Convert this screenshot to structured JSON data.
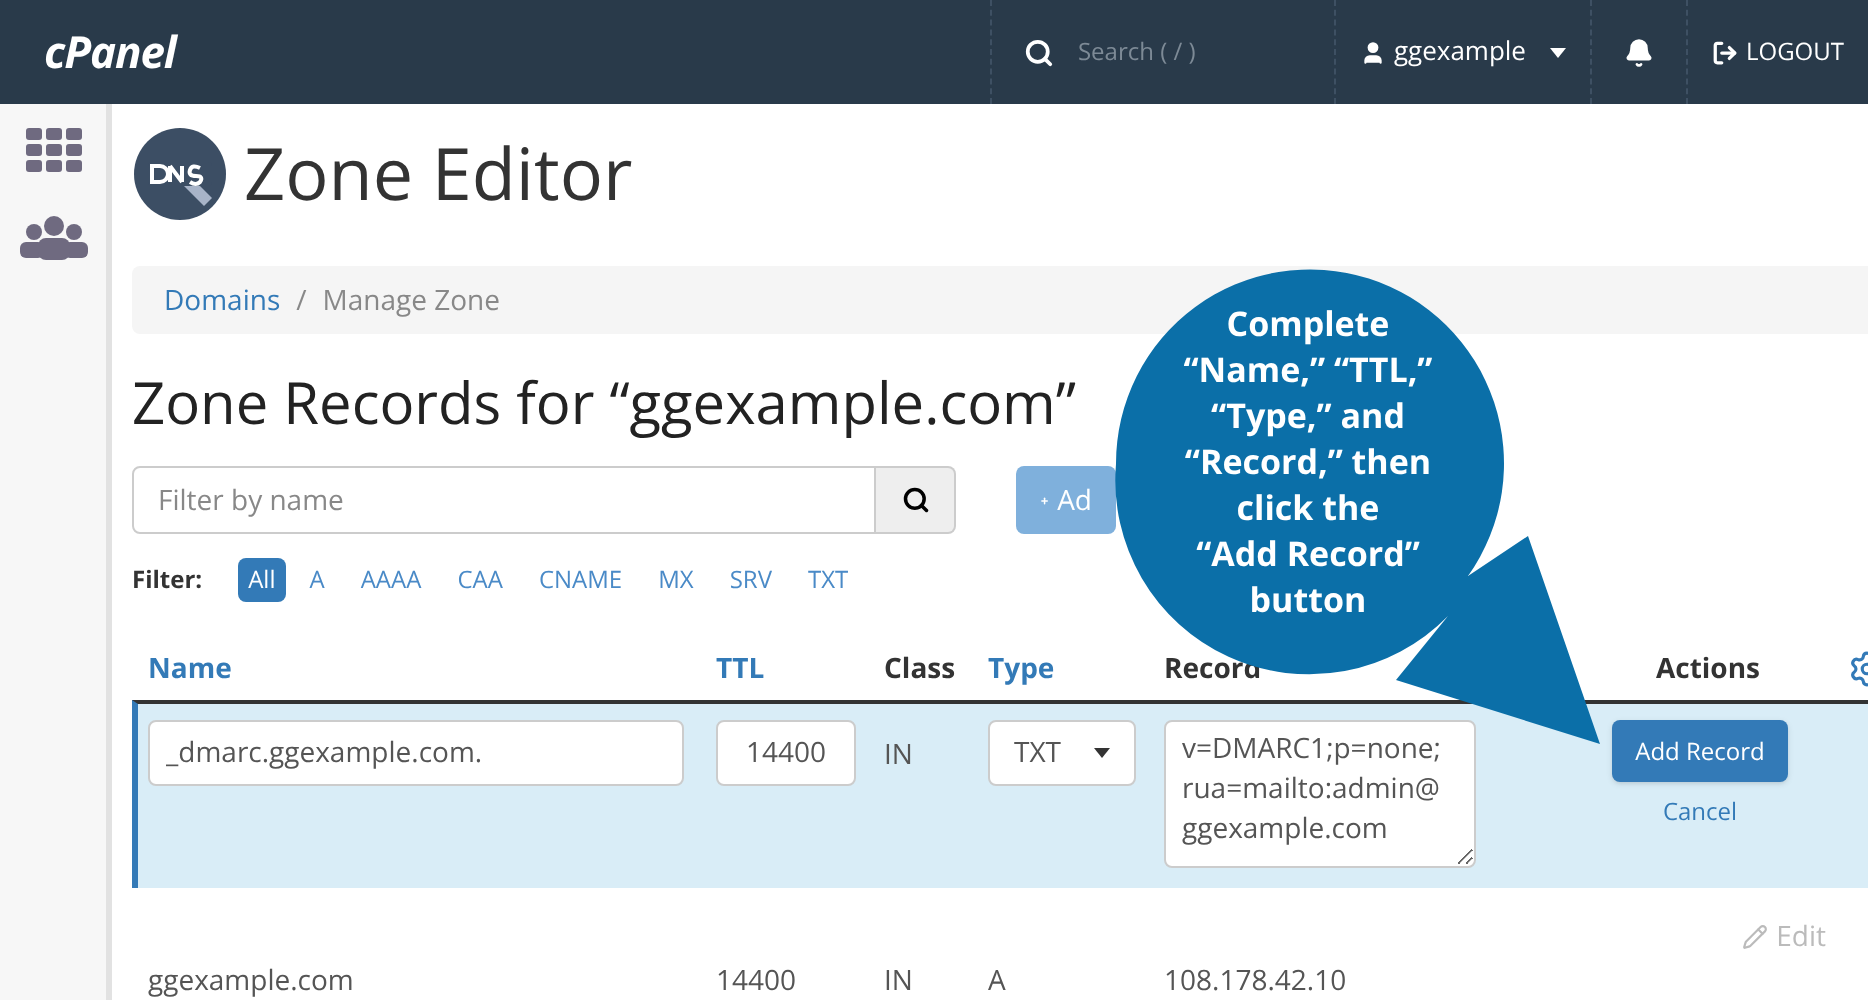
{
  "header": {
    "logo": "cPanel",
    "search": {
      "placeholder": "Search ( / )"
    },
    "user": "ggexample",
    "logout": "LOGOUT"
  },
  "page_title": "Zone Editor",
  "breadcrumb": [
    {
      "label": "Domains",
      "link": true
    },
    {
      "label": "/",
      "link": false
    },
    {
      "label": "Manage Zone",
      "link": false
    }
  ],
  "heading": "Zone Records for “ggexample.com”",
  "filter_field": {
    "placeholder": "Filter by name"
  },
  "add_button": "Ad",
  "filter": {
    "label": "Filter:",
    "options": [
      {
        "label": "All",
        "selected": true
      },
      {
        "label": "A",
        "selected": false
      },
      {
        "label": "AAAA",
        "selected": false
      },
      {
        "label": "CAA",
        "selected": false
      },
      {
        "label": "CNAME",
        "selected": false
      },
      {
        "label": "MX",
        "selected": false
      },
      {
        "label": "SRV",
        "selected": false
      },
      {
        "label": "TXT",
        "selected": false
      }
    ]
  },
  "table": {
    "columns": [
      {
        "label": "Name",
        "sortable": true
      },
      {
        "label": "TTL",
        "sortable": true
      },
      {
        "label": "Class",
        "sortable": false
      },
      {
        "label": "Type",
        "sortable": true
      },
      {
        "label": "Record",
        "sortable": false
      },
      {
        "label": "Actions",
        "sortable": false
      }
    ],
    "edit_row": {
      "name": "_dmarc.ggexample.com.",
      "ttl": "14400",
      "class": "IN",
      "type": "TXT",
      "record": "v=DMARC1;p=none;\nrua=mailto:admin@\nggexample.com",
      "save": "Add Record",
      "cancel": "Cancel"
    },
    "rows": [
      {
        "name": "ggexample.com",
        "ttl": "14400",
        "class": "IN",
        "type": "A",
        "record": "108.178.42.10",
        "action": "Edit"
      }
    ]
  },
  "callout": [
    "Complete",
    "“Name,” “TTL,”",
    "“Type,” and",
    "“Record,” then",
    "click the",
    "“Add Record”",
    "button"
  ]
}
